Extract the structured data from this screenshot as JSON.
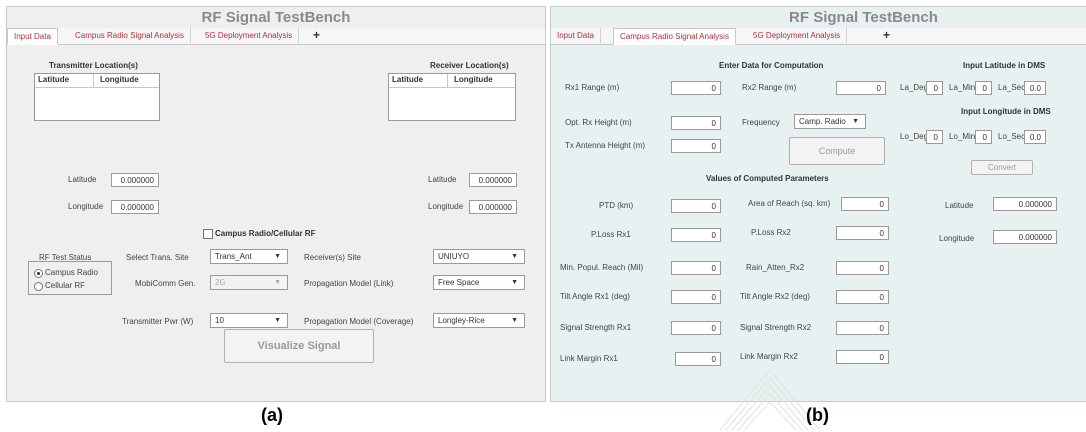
{
  "captions": {
    "a": "(a)",
    "b": "(b)"
  },
  "colors": {
    "tab_text": "#b0303a",
    "panel_a_bg": "#efefef",
    "panel_b_bg": "#e8f1f1"
  },
  "panelA": {
    "title": "RF Signal TestBench",
    "tabs": [
      "Input Data",
      "Campus Radio Signal Analysis",
      "5G Deployment Analysis",
      "+"
    ],
    "transmitter": {
      "heading": "Transmitter Location(s)",
      "col1": "Latitude",
      "col2": "Longitude",
      "lat_label": "Latitude",
      "lat_value": "0.000000",
      "lon_label": "Longitude",
      "lon_value": "0.000000"
    },
    "receiver": {
      "heading": "Receiver Location(s)",
      "col1": "Latitude",
      "col2": "Longitude",
      "lat_label": "Latitude",
      "lat_value": "0.000000",
      "lon_label": "Longitude",
      "lon_value": "0.000000"
    },
    "checkbox_label": "Campus Radio/Cellular RF",
    "status": {
      "title": "RF Test Status",
      "opt1": "Campus Radio",
      "opt2": "Cellular RF",
      "selected": "Campus Radio"
    },
    "trans_site": {
      "label": "Select Trans. Site",
      "value": "Trans_Ant"
    },
    "mobicomm": {
      "label": "MobiComm Gen.",
      "value": "2G"
    },
    "tx_power": {
      "label": "Transmitter Pwr (W)",
      "value": "10"
    },
    "receiver_site": {
      "label": "Receiver(s) Site",
      "value": "UNIUYO"
    },
    "prop_link": {
      "label": "Propagation Model (Link)",
      "value": "Free Space"
    },
    "prop_cov": {
      "label": "Propagation Model (Coverage)",
      "value": "Longley-Rice"
    },
    "visualize_button": "Visualize Signal"
  },
  "panelB": {
    "title": "RF Signal TestBench",
    "tabs": [
      "Input Data",
      "Campus Radio Signal Analysis",
      "5G Deployment Analysis",
      "+"
    ],
    "enter_heading": "Enter Data for Computation",
    "rx1_range": {
      "label": "Rx1 Range (m)",
      "value": "0"
    },
    "rx2_range": {
      "label": "Rx2 Range (m)",
      "value": "0"
    },
    "opt_rx_height": {
      "label": "Opt. Rx Height (m)",
      "value": "0"
    },
    "frequency": {
      "label": "Frequency",
      "value": "Camp. Radio"
    },
    "tx_ant_height": {
      "label": "Tx Antenna Height (m)",
      "value": "0"
    },
    "compute_button": "Compute",
    "computed_heading": "Values of Computed Parameters",
    "ptd": {
      "label": "PTD (km)",
      "value": "0"
    },
    "area_reach": {
      "label": "Area of Reach (sq. km)",
      "value": "0"
    },
    "ploss_rx1": {
      "label": "P.Loss Rx1",
      "value": "0"
    },
    "ploss_rx2": {
      "label": "P.Loss Rx2",
      "value": "0"
    },
    "min_popul": {
      "label": "Min. Popul. Reach (Mil)",
      "value": "0"
    },
    "rain_atten": {
      "label": "Rain_Atten_Rx2",
      "value": "0"
    },
    "tilt_rx1": {
      "label": "Tilt Angle Rx1 (deg)",
      "value": "0"
    },
    "tilt_rx2": {
      "label": "Tilt Angle Rx2 (deg)",
      "value": "0"
    },
    "sig_rx1": {
      "label": "Signal Strength Rx1",
      "value": "0"
    },
    "sig_rx2": {
      "label": "Signal Strength Rx2",
      "value": "0"
    },
    "link_rx1": {
      "label": "Link Margin Rx1",
      "value": "0"
    },
    "link_rx2": {
      "label": "Link Margin Rx2",
      "value": "0"
    },
    "lat_dms_heading": "Input Latitude in DMS",
    "la_deg": {
      "label": "La_Deg",
      "value": "0"
    },
    "la_min": {
      "label": "La_Min",
      "value": "0"
    },
    "la_sec": {
      "label": "La_Sec",
      "value": "0.0"
    },
    "lon_dms_heading": "Input Longitude in DMS",
    "lo_deg": {
      "label": "Lo_Deg",
      "value": "0"
    },
    "lo_min": {
      "label": "Lo_Min",
      "value": "0"
    },
    "lo_sec": {
      "label": "Lo_Sec",
      "value": "0.0"
    },
    "convert_button": "Convert",
    "latitude": {
      "label": "Latitude",
      "value": "0.000000"
    },
    "longitude": {
      "label": "Longitude",
      "value": "0.000000"
    }
  }
}
